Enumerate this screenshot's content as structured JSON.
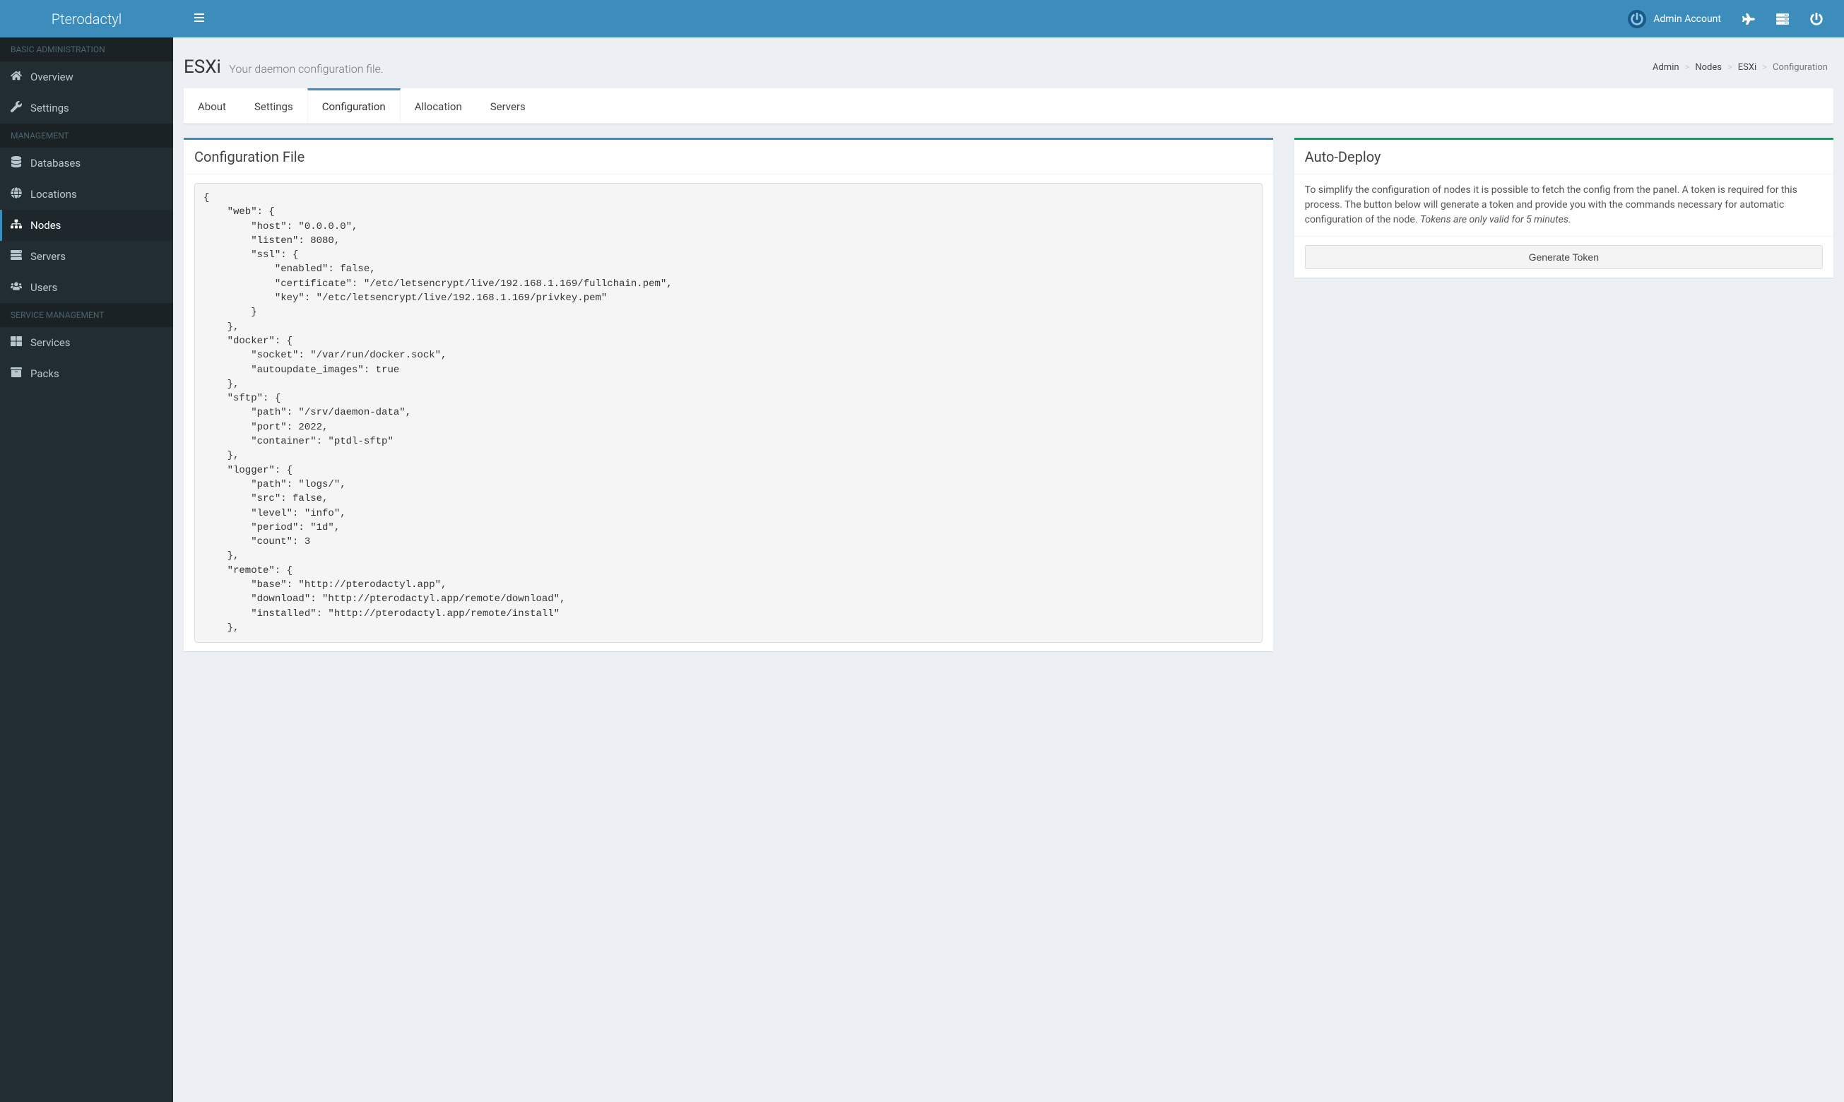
{
  "brand": "Pterodactyl",
  "user": {
    "name": "Admin Account"
  },
  "sidebar": {
    "sections": [
      {
        "header": "BASIC ADMINISTRATION",
        "items": [
          {
            "icon": "home",
            "label": "Overview",
            "active": false
          },
          {
            "icon": "wrench",
            "label": "Settings",
            "active": false
          }
        ]
      },
      {
        "header": "MANAGEMENT",
        "items": [
          {
            "icon": "database",
            "label": "Databases",
            "active": false
          },
          {
            "icon": "globe",
            "label": "Locations",
            "active": false
          },
          {
            "icon": "sitemap",
            "label": "Nodes",
            "active": true
          },
          {
            "icon": "server",
            "label": "Servers",
            "active": false
          },
          {
            "icon": "users",
            "label": "Users",
            "active": false
          }
        ]
      },
      {
        "header": "SERVICE MANAGEMENT",
        "items": [
          {
            "icon": "th-large",
            "label": "Services",
            "active": false
          },
          {
            "icon": "archive",
            "label": "Packs",
            "active": false
          }
        ]
      }
    ]
  },
  "page": {
    "title": "ESXi",
    "subtitle": "Your daemon configuration file.",
    "breadcrumb": [
      "Admin",
      "Nodes",
      "ESXi",
      "Configuration"
    ]
  },
  "tabs": [
    {
      "label": "About",
      "active": false
    },
    {
      "label": "Settings",
      "active": false
    },
    {
      "label": "Configuration",
      "active": true
    },
    {
      "label": "Allocation",
      "active": false
    },
    {
      "label": "Servers",
      "active": false
    }
  ],
  "configBox": {
    "title": "Configuration File",
    "json": "{\n    \"web\": {\n        \"host\": \"0.0.0.0\",\n        \"listen\": 8080,\n        \"ssl\": {\n            \"enabled\": false,\n            \"certificate\": \"/etc/letsencrypt/live/192.168.1.169/fullchain.pem\",\n            \"key\": \"/etc/letsencrypt/live/192.168.1.169/privkey.pem\"\n        }\n    },\n    \"docker\": {\n        \"socket\": \"/var/run/docker.sock\",\n        \"autoupdate_images\": true\n    },\n    \"sftp\": {\n        \"path\": \"/srv/daemon-data\",\n        \"port\": 2022,\n        \"container\": \"ptdl-sftp\"\n    },\n    \"logger\": {\n        \"path\": \"logs/\",\n        \"src\": false,\n        \"level\": \"info\",\n        \"period\": \"1d\",\n        \"count\": 3\n    },\n    \"remote\": {\n        \"base\": \"http://pterodactyl.app\",\n        \"download\": \"http://pterodactyl.app/remote/download\",\n        \"installed\": \"http://pterodactyl.app/remote/install\"\n    },"
  },
  "autoDeploy": {
    "title": "Auto-Deploy",
    "text": "To simplify the configuration of nodes it is possible to fetch the config from the panel. A token is required for this process. The button below will generate a token and provide you with the commands necessary for automatic configuration of the node. ",
    "emphText": "Tokens are only valid for 5 minutes.",
    "button": "Generate Token"
  }
}
